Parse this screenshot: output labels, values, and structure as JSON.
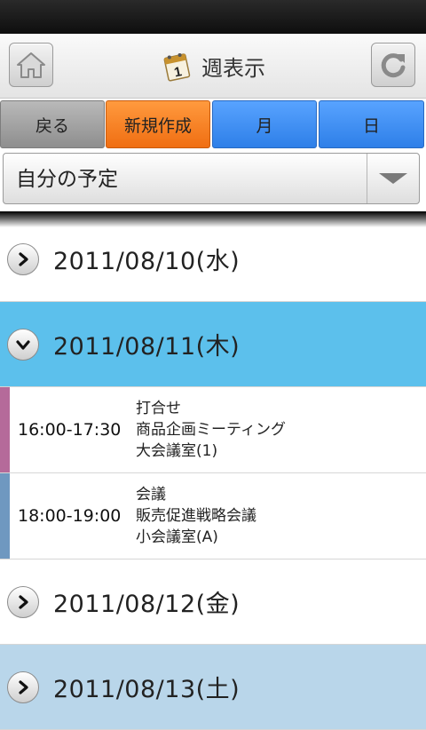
{
  "header": {
    "title": "週表示",
    "calendar_icon_day": "1"
  },
  "buttons": {
    "back": "戻る",
    "new": "新規作成",
    "month": "月",
    "day": "日"
  },
  "calendar_select": {
    "value": "自分の予定"
  },
  "days": [
    {
      "date": "2011/08/10",
      "weekday": "(水)"
    },
    {
      "date": "2011/08/11",
      "weekday": "(木)"
    },
    {
      "date": "2011/08/12",
      "weekday": "(金)"
    },
    {
      "date": "2011/08/13",
      "weekday": "(土)"
    }
  ],
  "events": [
    {
      "time": "16:00-17:30",
      "type": "打合せ",
      "title": "商品企画ミーティング",
      "place": "大会議室(1)",
      "color": "#b56a9a"
    },
    {
      "time": "18:00-19:00",
      "type": "会議",
      "title": "販売促進戦略会議",
      "place": "小会議室(A)",
      "color": "#6f98c0"
    }
  ],
  "colors": {
    "expanded_row": "#5cc0ec",
    "selected_row": "#b9d6ea",
    "new_button": "#f28022",
    "nav_button": "#3a8af0",
    "back_button": "#a5a5a5"
  }
}
